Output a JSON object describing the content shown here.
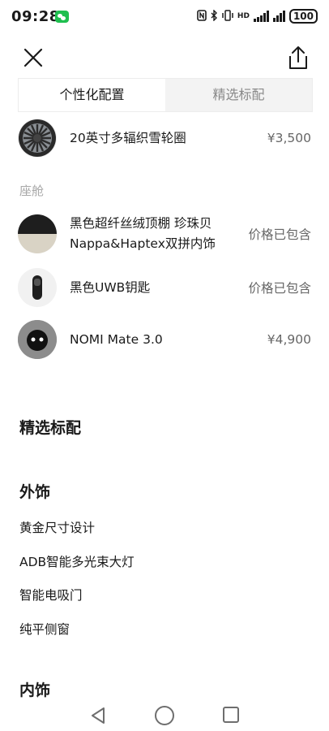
{
  "status_bar": {
    "time": "09:28",
    "battery": "100",
    "icons": [
      "wechat-icon",
      "nfc-icon",
      "bluetooth-icon",
      "vibrate-icon",
      "signal-icon",
      "signal-icon",
      "battery-icon"
    ]
  },
  "header": {
    "close_icon": "close-icon",
    "share_icon": "share-icon"
  },
  "tabs": [
    {
      "label": "个性化配置",
      "active": true
    },
    {
      "label": "精选标配",
      "active": false
    }
  ],
  "wheel_item": {
    "label": "20英寸多辐织雪轮圈",
    "price": "¥3,500"
  },
  "cabin": {
    "title": "座舱",
    "items": [
      {
        "label_line1": "黑色超纤丝绒顶棚 珍珠贝",
        "label_line2": "Nappa&Haptex双拼内饰",
        "price": "价格已包含"
      },
      {
        "label": "黑色UWB钥匙",
        "price": "价格已包含"
      },
      {
        "label": "NOMI Mate 3.0",
        "price": "¥4,900"
      }
    ]
  },
  "standard": {
    "title": "精选标配",
    "exterior": {
      "title": "外饰",
      "items": [
        "黄金尺寸设计",
        "ADB智能多光束大灯",
        "智能电吸门",
        "纯平侧窗"
      ]
    },
    "interior": {
      "title": "内饰"
    }
  },
  "nav": {
    "icons": [
      "back-icon",
      "home-icon",
      "recents-icon"
    ]
  }
}
